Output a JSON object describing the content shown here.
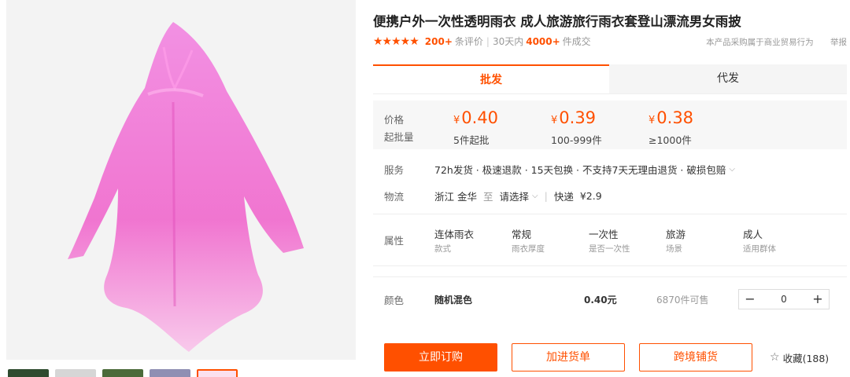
{
  "product": {
    "title": "便携户外一次性透明雨衣 成人旅游旅行雨衣套登山漂流男女雨披",
    "rating_stars": "★★★★★",
    "review_count": "200+",
    "review_suffix": "条评价",
    "sales_prefix": "30天内",
    "sales_count": "4000+",
    "sales_suffix": "件成交"
  },
  "notice": {
    "text": "本产品采购属于商业贸易行为",
    "report": "举报"
  },
  "tabs": [
    {
      "label": "批发",
      "active": true
    },
    {
      "label": "代发",
      "active": false
    }
  ],
  "pricing": {
    "price_label": "价格",
    "moq_label": "起批量",
    "currency": "¥",
    "tiers": [
      {
        "price": "0.40",
        "qty": "5件起批"
      },
      {
        "price": "0.39",
        "qty": "100-999件"
      },
      {
        "price": "0.38",
        "qty": "≥1000件"
      }
    ]
  },
  "service": {
    "label": "服务",
    "text": "72h发货 · 极速退款 · 15天包换 · 不支持7天无理由退货 · 破损包赔"
  },
  "logistics": {
    "label": "物流",
    "origin": "浙江 金华",
    "to": "至",
    "destination": "请选择",
    "express": "快递",
    "fee": "¥2.9"
  },
  "attributes": {
    "label": "属性",
    "items": [
      {
        "value": "连体雨衣",
        "key": "款式"
      },
      {
        "value": "常规",
        "key": "雨衣厚度"
      },
      {
        "value": "一次性",
        "key": "是否一次性"
      },
      {
        "value": "旅游",
        "key": "场景"
      },
      {
        "value": "成人",
        "key": "适用群体"
      }
    ]
  },
  "sku": {
    "label": "颜色",
    "color": "随机混色",
    "price": "0.40元",
    "stock": "6870件可售",
    "quantity": "0",
    "minus": "−",
    "plus": "+"
  },
  "actions": {
    "buy_now": "立即订购",
    "add_cart": "加进货单",
    "cross_border": "跨境铺货",
    "favorite": "收藏(188)"
  },
  "colors": {
    "accent": "#ff5000",
    "raincoat": "#f06ad0"
  }
}
